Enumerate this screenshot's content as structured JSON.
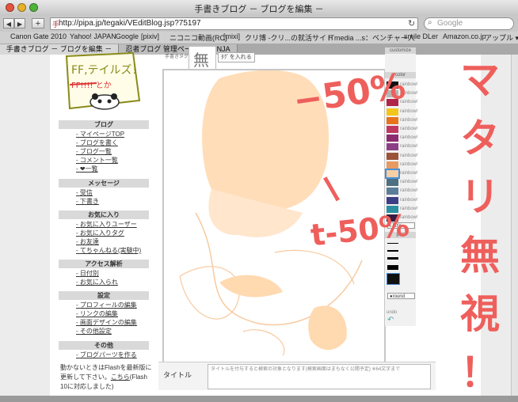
{
  "window": {
    "title": "手書きブログ － ブログを編集 －"
  },
  "toolbar": {
    "back": "◀",
    "forward": "▶",
    "add": "+",
    "url": "http://pipa.jp/tegaki/VEditBlog.jsp?75197",
    "reload": "↻",
    "search_placeholder": "Google",
    "search_icon": "magnifier-icon"
  },
  "bookmarks": [
    "Canon Gate 2010",
    "Yahoo! JAPAN",
    "Google",
    "[pixiv]",
    "ニコニコ動画(RC)",
    "[mixi]",
    "クリ博 -クリ...の就活サイト",
    "ITmedia ...s：ベンチャー人",
    "smile DLer",
    "Amazon.co.jp",
    "アップル ▾"
  ],
  "tabs": [
    {
      "label": "手書きブログ － ブログを編集 －"
    },
    {
      "label": "忍者ブログ 管理ページ － NINJA TOOLS"
    }
  ],
  "sidebar": {
    "doodle_text": [
      "FF,テイルズ！",
      "FF!!!! とか"
    ],
    "sections": [
      {
        "title": "ブログ",
        "items": [
          "マイページTOP",
          "ブログを書く",
          "ブログ一覧",
          "コメント一覧",
          "❤一覧"
        ]
      },
      {
        "title": "メッセージ",
        "items": [
          "受信",
          "下書き"
        ]
      },
      {
        "title": "お気に入り",
        "items": [
          "お気に入りユーザー",
          "お気に入りタグ",
          "お友達",
          "てちゃんねる(実験中)"
        ]
      },
      {
        "title": "アクセス解析",
        "items": [
          "日付別",
          "お気に入られ"
        ]
      },
      {
        "title": "設定",
        "items": [
          "プロフィールの編集",
          "リンクの編集",
          "画面デザインの編集",
          "その他設定"
        ]
      },
      {
        "title": "その他",
        "items": [
          "ブログパーツを作る"
        ]
      }
    ],
    "flash_note": "動かないときはFlashを最新版に更新して下さい。",
    "flash_link": "こちら",
    "flash_note2": "(Flash 10に対応しました)"
  },
  "editor": {
    "stamp_label": "手書きタグ",
    "stamp_button": "ﾀｸﾞを入れる",
    "palette_head": "customize",
    "color_head": "color",
    "swatches": [
      {
        "color": "#111111",
        "name": "rainbow!"
      },
      {
        "color": "#b5b5b5",
        "name": "rainbow!"
      },
      {
        "color": "#b0244a",
        "name": "rainbow!"
      },
      {
        "color": "#f4c51c",
        "name": "rainbow!"
      },
      {
        "color": "#e7731c",
        "name": "rainbow!"
      },
      {
        "color": "#c0385f",
        "name": "rainbow!"
      },
      {
        "color": "#8d2b70",
        "name": "rainbow!"
      },
      {
        "color": "#8c3f85",
        "name": "rainbow!"
      },
      {
        "color": "#9a5339",
        "name": "rainbow!"
      },
      {
        "color": "#e89a63",
        "name": "rainbow!"
      },
      {
        "color": "#f6cfa4",
        "name": "rainbow!"
      },
      {
        "color": "#4d6f82",
        "name": "rainbow!"
      },
      {
        "color": "#5c7d97",
        "name": "rainbow!"
      },
      {
        "color": "#3c3f86",
        "name": "rainbow!"
      },
      {
        "color": "#2a8fa0",
        "name": "rainbow!"
      },
      {
        "color": "#361d3f",
        "name": "rainbow!"
      }
    ],
    "opacity_select": "t-50%",
    "pen_head": "pen",
    "round_select": "●round",
    "undo": "undo",
    "title_label": "タイトル",
    "title_hint": "タイトルを付与すると検索の対象となります(検索画面はまもなく公開予定) ※64文字まで"
  },
  "handwriting": {
    "minus50": "−50%",
    "dash": "ー",
    "t50": "t-50%",
    "vertical": [
      "マ",
      "タ",
      "リ",
      "無",
      "視",
      "！"
    ]
  }
}
